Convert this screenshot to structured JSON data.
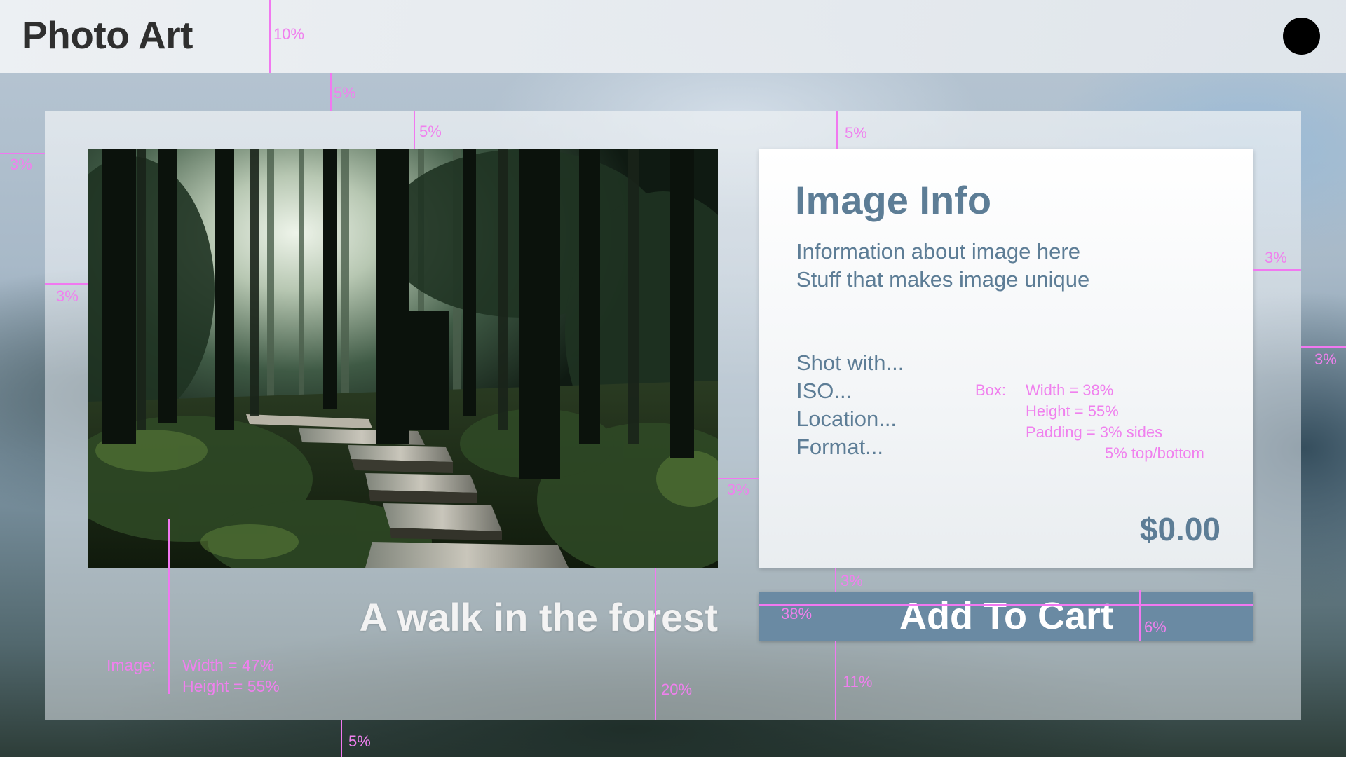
{
  "header": {
    "brand": "Photo Art",
    "avatar_icon": "user-avatar-icon"
  },
  "photo": {
    "subject": "forest-boardwalk-photo",
    "caption": "A walk in the forest"
  },
  "info_box": {
    "title": "Image Info",
    "lines": [
      "Information about image here",
      "Stuff that makes image unique"
    ],
    "specs": [
      "Shot with...",
      "ISO...",
      "Location...",
      "Format..."
    ],
    "price": "$0.00"
  },
  "cart_button": {
    "label": "Add To Cart"
  },
  "annotations": {
    "header_height": "10%",
    "gap_top_a": "5%",
    "gap_top_b": "5%",
    "gap_top_c": "5%",
    "left_edge": "3%",
    "image_left": "3%",
    "image_info_gap": "3%",
    "info_right": "3%",
    "panel_right": "3%",
    "info_btn_gap": "3%",
    "btn_width": "38%",
    "btn_height": "6%",
    "btn_bottom": "11%",
    "caption_bottom": "20%",
    "panel_bottom": "5%",
    "image_spec": {
      "label": "Image:",
      "width": "Width = 47%",
      "height": "Height = 55%"
    },
    "box_spec": {
      "label": "Box:",
      "width": "Width = 38%",
      "height": "Height = 55%",
      "padding": "Padding = 3% sides",
      "padding2": "5% top/bottom"
    }
  },
  "colors": {
    "accent": "#5d7d96",
    "button": "#6a8aa3",
    "annotation": "#f178f0"
  }
}
